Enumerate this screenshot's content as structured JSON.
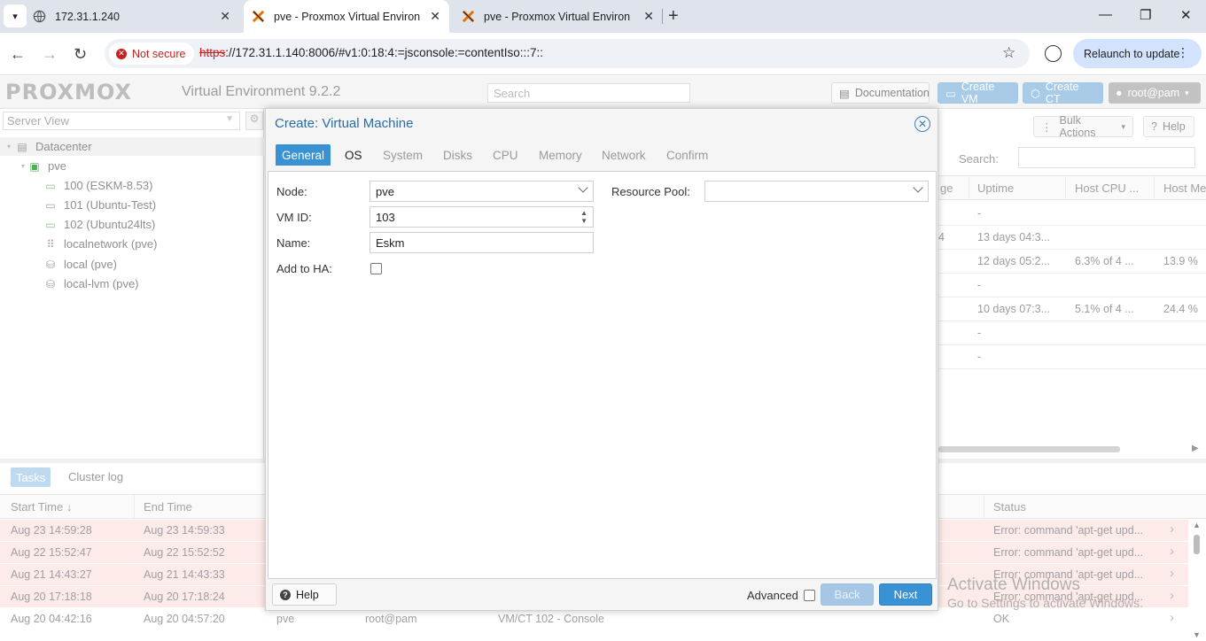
{
  "browser": {
    "tabs": [
      {
        "title": "172.31.1.240"
      },
      {
        "title": "pve - Proxmox Virtual Environm"
      },
      {
        "title": "pve - Proxmox Virtual Environm"
      }
    ],
    "security_label": "Not secure",
    "url_scheme": "https",
    "url_rest": "://172.31.1.140:8006/#v1:0:18:4:=jsconsole:=contentIso:::7::",
    "relaunch_label": "Relaunch to update"
  },
  "header": {
    "logo_text": "PROXMOX",
    "version": "Virtual Environment 9.2.2",
    "search_placeholder": "Search",
    "documentation_label": "Documentation",
    "create_vm_label": "Create VM",
    "create_ct_label": "Create CT",
    "user_label": "root@pam"
  },
  "sidebar": {
    "view": "Server View",
    "datacenter": "Datacenter",
    "node": "pve",
    "items": [
      {
        "label": "100 (ESKM-8.53)",
        "icon": "vm-running-icon"
      },
      {
        "label": "101 (Ubuntu-Test)",
        "icon": "vm-stopped-icon"
      },
      {
        "label": "102 (Ubuntu24lts)",
        "icon": "vm-running-icon"
      },
      {
        "label": "localnetwork (pve)",
        "icon": "network-grid-icon"
      },
      {
        "label": "local (pve)",
        "icon": "storage-icon"
      },
      {
        "label": "local-lvm (pve)",
        "icon": "storage-icon"
      }
    ]
  },
  "content": {
    "bulk_actions_label": "Bulk Actions",
    "help_label": "Help",
    "search_label": "Search:",
    "columns": [
      "ge",
      "Uptime",
      "Host CPU ...",
      "Host Me"
    ],
    "rows": [
      {
        "col1": "",
        "uptime": "-",
        "cpu": "",
        "mem": ""
      },
      {
        "col1": "4",
        "uptime": "13 days 04:3...",
        "cpu": "",
        "mem": ""
      },
      {
        "col1": "",
        "uptime": "12 days 05:2...",
        "cpu": "6.3% of 4 ...",
        "mem": "13.9 %"
      },
      {
        "col1": "",
        "uptime": "-",
        "cpu": "",
        "mem": ""
      },
      {
        "col1": "",
        "uptime": "10 days 07:3...",
        "cpu": "5.1% of 4 ...",
        "mem": "24.4 %"
      },
      {
        "col1": "",
        "uptime": "-",
        "cpu": "",
        "mem": ""
      },
      {
        "col1": "",
        "uptime": "-",
        "cpu": "",
        "mem": ""
      }
    ]
  },
  "tasks": {
    "tab_tasks": "Tasks",
    "tab_cluster_log": "Cluster log",
    "columns": {
      "start": "Start Time ↓",
      "end": "End Time",
      "status": "Status"
    },
    "rows": [
      {
        "start": "Aug 23 14:59:28",
        "end": "Aug 23 14:59:33",
        "node": "",
        "user": "",
        "desc": "",
        "status": "Error: command 'apt-get upd...",
        "error": true
      },
      {
        "start": "Aug 22 15:52:47",
        "end": "Aug 22 15:52:52",
        "node": "",
        "user": "",
        "desc": "",
        "status": "Error: command 'apt-get upd...",
        "error": true
      },
      {
        "start": "Aug 21 14:43:27",
        "end": "Aug 21 14:43:33",
        "node": "",
        "user": "",
        "desc": "",
        "status": "Error: command 'apt-get upd...",
        "error": true
      },
      {
        "start": "Aug 20 17:18:18",
        "end": "Aug 20 17:18:24",
        "node": "",
        "user": "",
        "desc": "",
        "status": "Error: command 'apt-get upd...",
        "error": true
      },
      {
        "start": "Aug 20 04:42:16",
        "end": "Aug 20 04:57:20",
        "node": "pve",
        "user": "root@pam",
        "desc": "VM/CT 102 - Console",
        "status": "OK",
        "error": false
      }
    ]
  },
  "watermark": {
    "line1": "Activate Windows",
    "line2": "Go to Settings to activate Windows."
  },
  "dialog": {
    "title": "Create: Virtual Machine",
    "tabs": [
      "General",
      "OS",
      "System",
      "Disks",
      "CPU",
      "Memory",
      "Network",
      "Confirm"
    ],
    "fields": {
      "node_label": "Node:",
      "node_value": "pve",
      "vmid_label": "VM ID:",
      "vmid_value": "103",
      "name_label": "Name:",
      "name_value": "Eskm",
      "ha_label": "Add to HA:",
      "pool_label": "Resource Pool:",
      "pool_value": ""
    },
    "footer": {
      "help_label": "Help",
      "advanced_label": "Advanced",
      "back_label": "Back",
      "next_label": "Next"
    }
  }
}
